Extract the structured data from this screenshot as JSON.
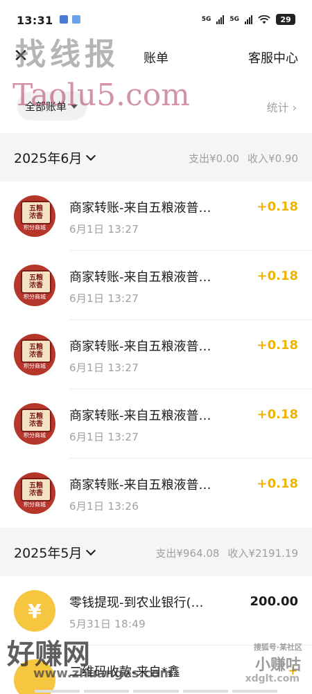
{
  "status": {
    "time": "13:31",
    "battery": "29",
    "signal1": "5G",
    "signal2": "5G"
  },
  "nav": {
    "close_glyph": "✕",
    "title": "账单",
    "service": "客服中心"
  },
  "filter": {
    "label": "全部账单",
    "stats": "统计"
  },
  "months": [
    {
      "label": "2025年6月",
      "expense": "支出¥0.00",
      "income": "收入¥0.90",
      "items": [
        {
          "title": "商家转账-来自五粮液普…",
          "time": "6月1日 13:27",
          "amount": "+0.18",
          "avatar_text": "五粮\n浓香",
          "avatar_sub": "积分商城"
        },
        {
          "title": "商家转账-来自五粮液普…",
          "time": "6月1日 13:27",
          "amount": "+0.18",
          "avatar_text": "五粮\n浓香",
          "avatar_sub": "积分商城"
        },
        {
          "title": "商家转账-来自五粮液普…",
          "time": "6月1日 13:27",
          "amount": "+0.18",
          "avatar_text": "五粮\n浓香",
          "avatar_sub": "积分商城"
        },
        {
          "title": "商家转账-来自五粮液普…",
          "time": "6月1日 13:27",
          "amount": "+0.18",
          "avatar_text": "五粮\n浓香",
          "avatar_sub": "积分商城"
        },
        {
          "title": "商家转账-来自五粮液普…",
          "time": "6月1日 13:26",
          "amount": "+0.18",
          "avatar_text": "五粮\n浓香",
          "avatar_sub": "积分商城"
        }
      ]
    },
    {
      "label": "2025年5月",
      "expense": "支出¥964.08",
      "income": "收入¥2191.19",
      "items": [
        {
          "title": "零钱提现-到农业银行(…",
          "time": "5月31日 18:49",
          "amount": "200.00",
          "coin": "¥"
        },
        {
          "title": "二维码收款-来自*鑫",
          "time": "",
          "amount": "+"
        }
      ]
    }
  ],
  "watermarks": {
    "wm1": "找线报",
    "wm2": "Taolu5.com",
    "wm3": "好赚网",
    "wm4": "www.zhuanges.com",
    "wm5": "搜狐号·某社区",
    "wm6": "小赚咕",
    "wm7": "xdglt.com"
  },
  "colors": {
    "income": "#f0b400",
    "muted": "#a0a0a0",
    "section_bg": "#f5f5f5"
  }
}
